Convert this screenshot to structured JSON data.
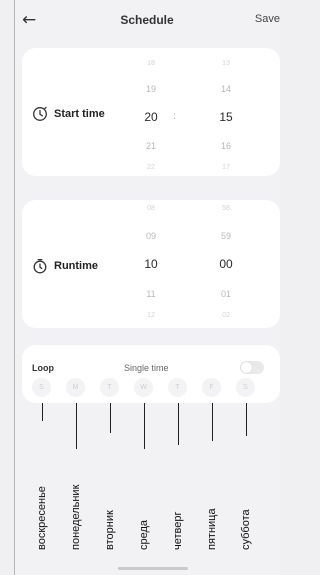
{
  "header": {
    "title": "Schedule",
    "save_label": "Save",
    "back_icon": "arrow-left-icon"
  },
  "start_time": {
    "label": "Start time",
    "icon": "clock-icon",
    "hours": [
      "18",
      "19",
      "20",
      "21",
      "22"
    ],
    "minutes": [
      "13",
      "14",
      "15",
      "16",
      "17"
    ],
    "separator": ":"
  },
  "runtime": {
    "label": "Runtime",
    "icon": "timer-icon",
    "hours": [
      "08",
      "09",
      "10",
      "11",
      "12"
    ],
    "minutes": [
      "58",
      "59",
      "00",
      "01",
      "02"
    ]
  },
  "loop": {
    "label": "Loop",
    "mode": "Single time",
    "toggle_on": false,
    "days": [
      "S",
      "M",
      "T",
      "W",
      "T",
      "F",
      "S"
    ]
  },
  "annotations": [
    "воскресенье",
    "понедельник",
    "вторник",
    "среда",
    "четверг",
    "пятница",
    "суббота"
  ]
}
